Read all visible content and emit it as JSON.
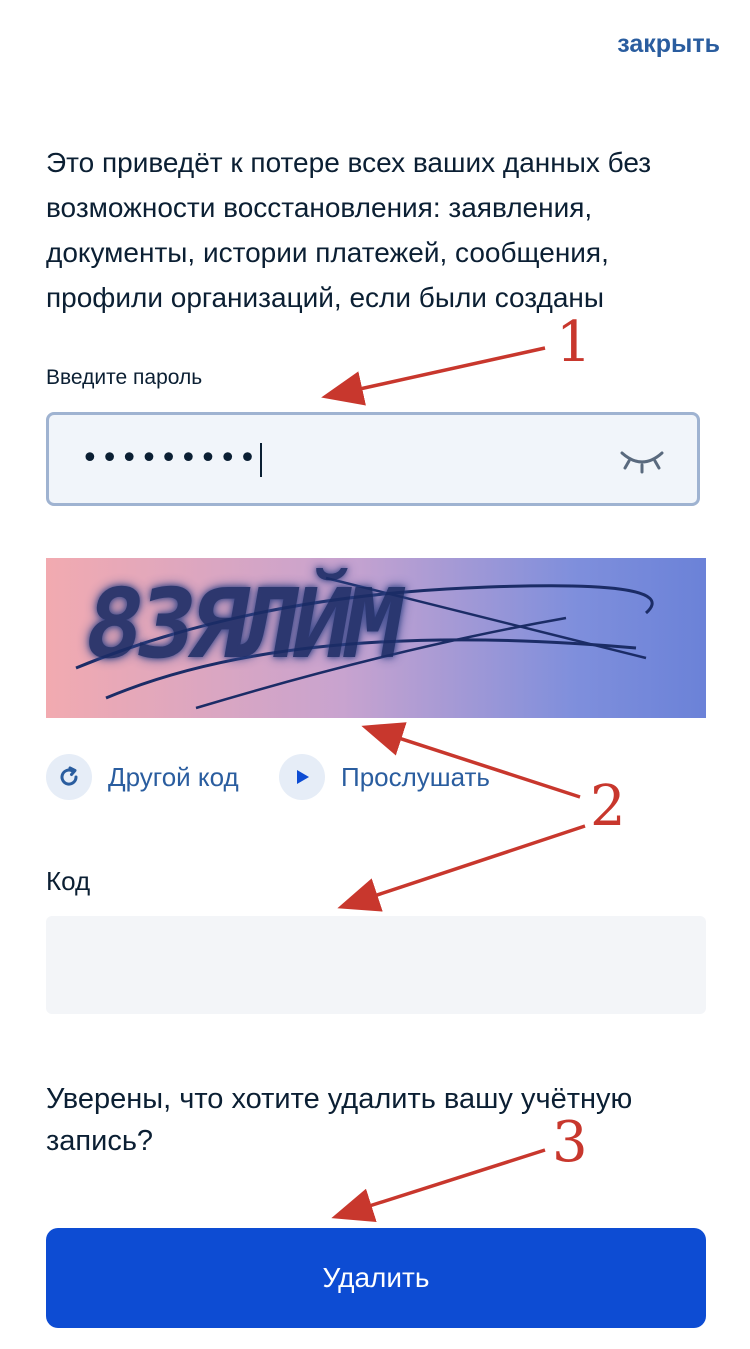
{
  "header": {
    "close_label": "закрыть"
  },
  "warning": {
    "text": "Это приведёт к потере всех ваших данных без возможности восстановления: заявления, документы, истории платежей, сообщения, профили организаций, если были созданы"
  },
  "password": {
    "label": "Введите пароль",
    "value_masked": "•••••••••",
    "toggle_icon": "eye-closed-icon"
  },
  "captcha": {
    "image_text": "8ЗЯЛЙМ",
    "refresh_label": "Другой код",
    "refresh_icon": "refresh-icon",
    "listen_label": "Прослушать",
    "listen_icon": "play-icon"
  },
  "code": {
    "label": "Код",
    "value": ""
  },
  "confirm": {
    "question": "Уверены, что хотите удалить вашу учётную запись?",
    "delete_label": "Удалить"
  },
  "annotations": {
    "one": "1",
    "two": "2",
    "three": "3",
    "color": "#c8372d"
  },
  "colors": {
    "primary": "#0d4cd3",
    "link": "#2a5d9f",
    "text": "#0b1f33",
    "field_bg": "#f1f5fa",
    "field_border": "#9fb3d1"
  }
}
